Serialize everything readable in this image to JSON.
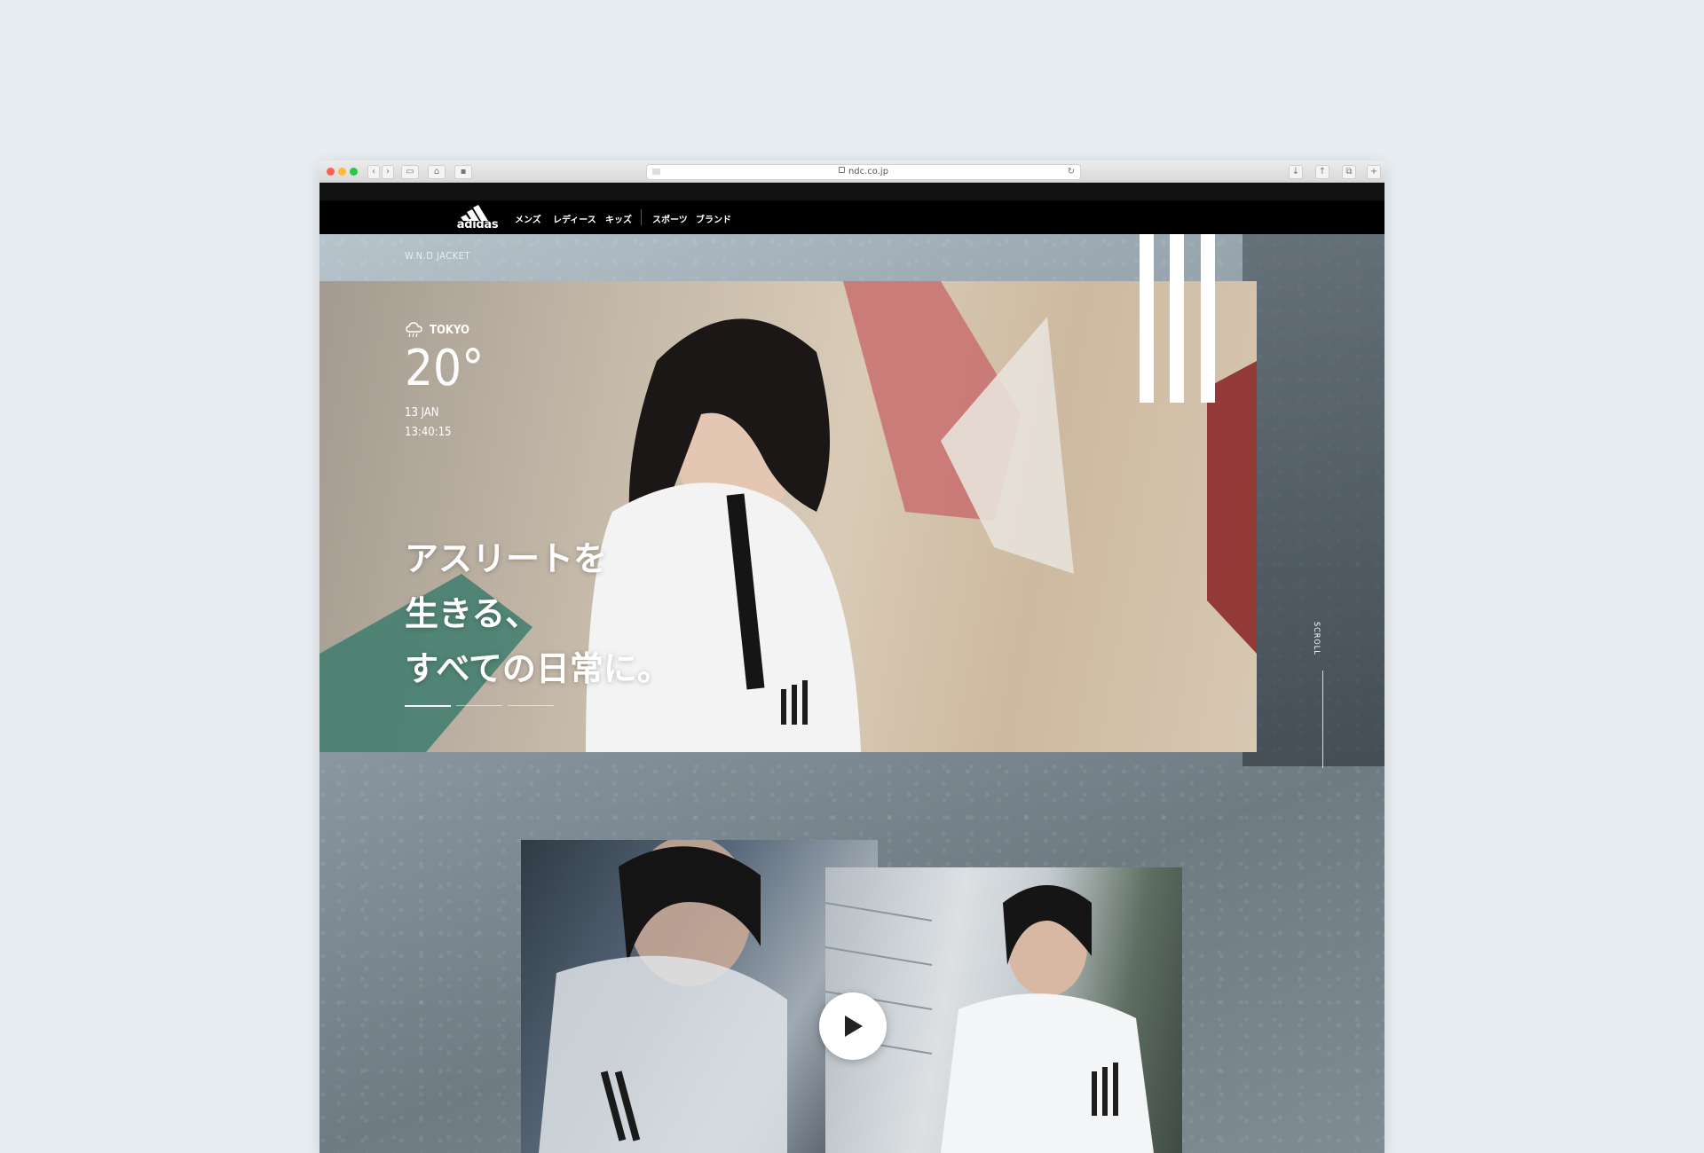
{
  "browser": {
    "url": "ndc.co.jp",
    "tab_icons": [
      "back-icon",
      "forward-icon",
      "sidebar-icon",
      "home-icon",
      "share-icon"
    ],
    "reload_icon": "reload-icon",
    "right_icons": [
      "download-icon",
      "share-icon",
      "tabs-icon",
      "new-tab-icon"
    ]
  },
  "header": {
    "logo_text": "adidas",
    "nav": [
      "メンズ",
      "レディース",
      "キッズ",
      "スポーツ",
      "ブランド"
    ]
  },
  "hero": {
    "product_label": "W.N.D JACKET",
    "weather": {
      "icon": "rain-cloud-icon",
      "city": "TOKYO",
      "temperature": "20°",
      "date": "13 JAN",
      "time": "13:40:15"
    },
    "headline": [
      "アスリートを",
      "生きる、",
      "すべての日常に。"
    ],
    "slide_count": 3,
    "active_slide": 1,
    "scroll_label": "SCROLL"
  },
  "video": {
    "play_icon": "play-icon"
  },
  "colors": {
    "nav_bg": "#000000",
    "page_bg": "#e8edf1",
    "text_on_photo": "#ffffff"
  }
}
